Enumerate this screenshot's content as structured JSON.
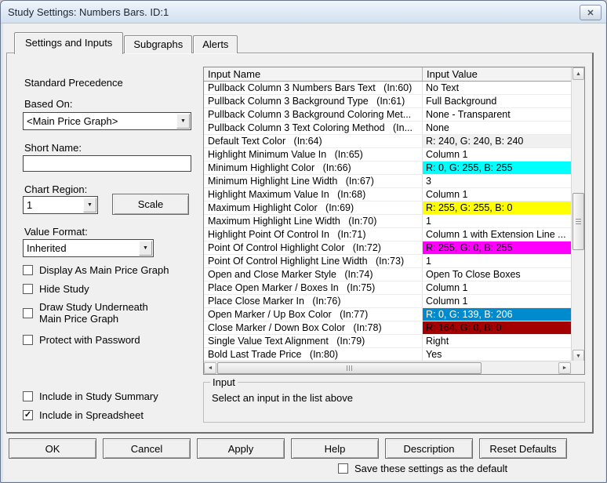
{
  "window": {
    "title": "Study Settings: Numbers Bars. ID:1"
  },
  "icons": {
    "close": "✕",
    "dropdown_arrow": "▼",
    "scroll_up": "▲",
    "scroll_down": "▼",
    "scroll_left": "◄",
    "scroll_right": "►",
    "checkmark": "✓"
  },
  "tabs": [
    {
      "label": "Settings and Inputs",
      "active": true
    },
    {
      "label": "Subgraphs",
      "active": false
    },
    {
      "label": "Alerts",
      "active": false
    }
  ],
  "left_panel": {
    "standard_precedence": "Standard Precedence",
    "based_on_label": "Based On:",
    "based_on_value": "<Main Price Graph>",
    "short_name_label": "Short Name:",
    "short_name_value": "",
    "chart_region_label": "Chart Region:",
    "chart_region_value": "1",
    "scale_button": "Scale",
    "value_format_label": "Value Format:",
    "value_format_value": "Inherited",
    "checkboxes": [
      {
        "label": "Display As Main Price Graph",
        "checked": false
      },
      {
        "label": "Hide Study",
        "checked": false
      },
      {
        "label": "Draw Study Underneath\nMain Price Graph",
        "checked": false
      },
      {
        "label": "Protect with Password",
        "checked": false
      }
    ],
    "bottom_checkboxes": [
      {
        "label": "Include in Study Summary",
        "checked": false
      },
      {
        "label": "Include in Spreadsheet",
        "checked": true
      }
    ]
  },
  "inputs_table": {
    "columns": [
      "Input Name",
      "Input Value"
    ],
    "rows": [
      {
        "name": "Pullback Column 3 Numbers Bars Text   (In:60)",
        "value": "No Text"
      },
      {
        "name": "Pullback Column 3 Background Type   (In:61)",
        "value": "Full Background"
      },
      {
        "name": "Pullback Column 3 Background Coloring Met...",
        "value": "None - Transparent"
      },
      {
        "name": "Pullback Column 3 Text Coloring Method   (In...",
        "value": "None"
      },
      {
        "name": "Default Text Color   (In:64)",
        "value": "R: 240, G: 240, B: 240",
        "value_bg": "#F0F0F0"
      },
      {
        "name": "Highlight Minimum Value In   (In:65)",
        "value": "Column 1"
      },
      {
        "name": "Minimum Highlight Color   (In:66)",
        "value": "R: 0, G: 255, B: 255",
        "value_bg": "#00FFFF"
      },
      {
        "name": "Minimum Highlight Line Width   (In:67)",
        "value": "3"
      },
      {
        "name": "Highlight Maximum Value In   (In:68)",
        "value": "Column 1"
      },
      {
        "name": "Maximum Highlight Color   (In:69)",
        "value": "R: 255, G: 255, B: 0",
        "value_bg": "#FFFF00"
      },
      {
        "name": "Maximum Highlight Line Width   (In:70)",
        "value": "1"
      },
      {
        "name": "Highlight Point Of Control In   (In:71)",
        "value": "Column 1 with Extension Line ..."
      },
      {
        "name": "Point Of Control Highlight Color   (In:72)",
        "value": "R: 255, G: 0, B: 255",
        "value_bg": "#FF00FF"
      },
      {
        "name": "Point Of Control Highlight Line Width   (In:73)",
        "value": "1"
      },
      {
        "name": "Open and Close Marker Style   (In:74)",
        "value": "Open To Close Boxes"
      },
      {
        "name": "Place Open Marker / Boxes In   (In:75)",
        "value": "Column 1"
      },
      {
        "name": "Place Close Marker In   (In:76)",
        "value": "Column 1"
      },
      {
        "name": "Open Marker / Up Box Color   (In:77)",
        "value": "R: 0, G: 139, B: 206",
        "value_bg": "#008BCE",
        "value_fg": "#FFFFFF"
      },
      {
        "name": "Close Marker / Down Box Color   (In:78)",
        "value": "R: 164, G: 0, B: 0",
        "value_bg": "#A40000",
        "value_fg": "#000000"
      },
      {
        "name": "Single Value Text Alignment   (In:79)",
        "value": "Right"
      },
      {
        "name": "Bold Last Trade Price   (In:80)",
        "value": "Yes"
      }
    ]
  },
  "input_group": {
    "title": "Input",
    "message": "Select an input in the list above"
  },
  "footer": {
    "buttons": [
      "OK",
      "Cancel",
      "Apply",
      "Help",
      "Description",
      "Reset Defaults"
    ],
    "save_checkbox": {
      "label": "Save these settings as the default",
      "checked": false
    }
  }
}
